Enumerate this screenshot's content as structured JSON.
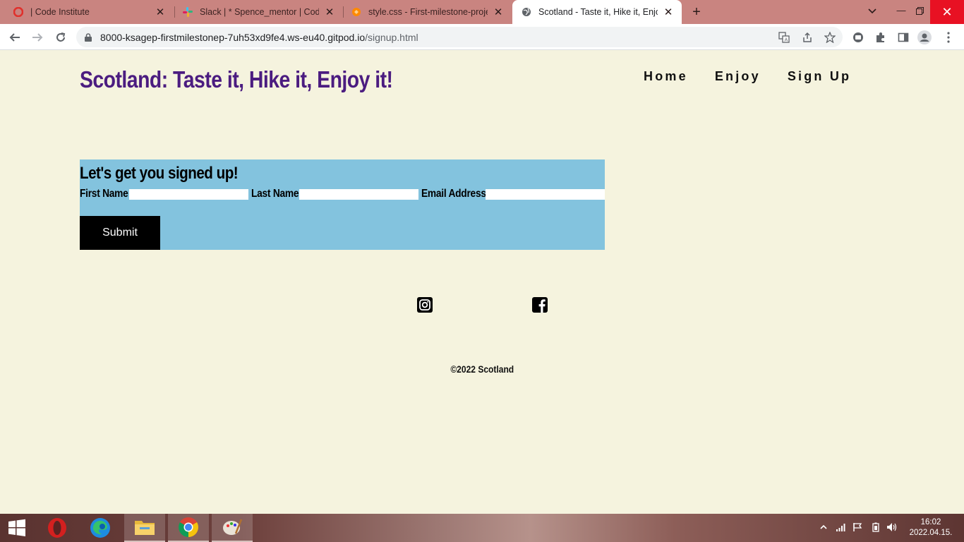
{
  "browser": {
    "tabs": [
      {
        "title": "| Code Institute",
        "active": false
      },
      {
        "title": "Slack | * Spence_mentor | Code Institute",
        "active": false
      },
      {
        "title": "style.css - First-milestone-project",
        "active": false
      },
      {
        "title": "Scotland - Taste it, Hike it, Enjoy it!",
        "active": true
      }
    ],
    "new_tab_symbol": "+",
    "address": {
      "host": "8000-ksagep-firstmilestonep-7uh53xd9fe4.ws-eu40.gitpod.io",
      "path": "/signup.html"
    },
    "colors": {
      "tabstrip": "#c98480",
      "close_hover": "#e81123"
    }
  },
  "site": {
    "title": "Scotland: Taste it, Hike it, Enjoy it!",
    "title_color": "#4b1c80",
    "nav": [
      "Home",
      "Enjoy",
      "Sign Up"
    ],
    "signup": {
      "heading": "Let's get you signed up!",
      "first_name_label": "First Name",
      "last_name_label": "Last Name",
      "email_label": "Email Address",
      "first_name_value": "",
      "last_name_value": "",
      "email_value": "",
      "submit_label": "Submit",
      "background": "#83c3de"
    },
    "social_icons": [
      "instagram-icon",
      "facebook-icon"
    ],
    "copyright": "©2022 Scotland",
    "page_background": "#f5f3de"
  },
  "taskbar": {
    "apps": [
      "start-icon",
      "opera-icon",
      "edge-icon",
      "file-explorer-icon",
      "chrome-icon",
      "paint-icon"
    ],
    "time": "16:02",
    "date": "2022.04.15."
  }
}
